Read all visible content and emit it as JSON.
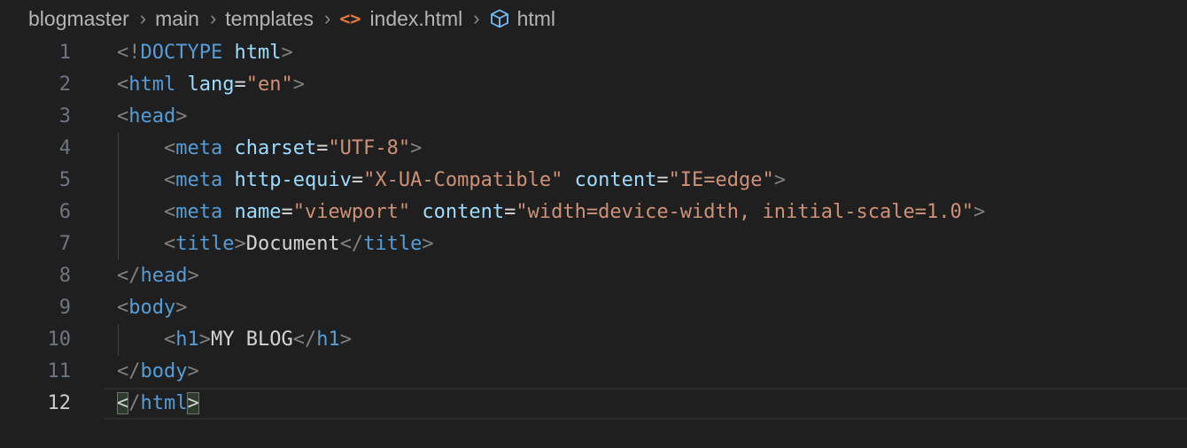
{
  "breadcrumb": {
    "items": [
      "blogmaster",
      "main",
      "templates",
      "index.html",
      "html"
    ],
    "separator": "›"
  },
  "icons": {
    "file": "html-file-icon",
    "symbol": "cube-icon"
  },
  "colors": {
    "background": "#1f1f1f",
    "tag": "#569cd6",
    "attribute": "#9cdcfe",
    "string": "#ce9178",
    "bracket": "#808080",
    "text": "#d4d4d4",
    "file_icon": "#e3793a"
  },
  "editor": {
    "current_line": 12,
    "lines": [
      {
        "n": "1",
        "tokens": [
          [
            "b",
            "<!"
          ],
          [
            "t",
            "DOCTYPE"
          ],
          [
            "x",
            " "
          ],
          [
            "a",
            "html"
          ],
          [
            "b",
            ">"
          ]
        ]
      },
      {
        "n": "2",
        "tokens": [
          [
            "b",
            "<"
          ],
          [
            "t",
            "html"
          ],
          [
            "x",
            " "
          ],
          [
            "a",
            "lang"
          ],
          [
            "x",
            "="
          ],
          [
            "s",
            "\"en\""
          ],
          [
            "b",
            ">"
          ]
        ]
      },
      {
        "n": "3",
        "tokens": [
          [
            "b",
            "<"
          ],
          [
            "t",
            "head"
          ],
          [
            "b",
            ">"
          ]
        ]
      },
      {
        "n": "4",
        "indent": true,
        "tokens": [
          [
            "x",
            "    "
          ],
          [
            "b",
            "<"
          ],
          [
            "t",
            "meta"
          ],
          [
            "x",
            " "
          ],
          [
            "a",
            "charset"
          ],
          [
            "x",
            "="
          ],
          [
            "s",
            "\"UTF-8\""
          ],
          [
            "b",
            ">"
          ]
        ]
      },
      {
        "n": "5",
        "indent": true,
        "tokens": [
          [
            "x",
            "    "
          ],
          [
            "b",
            "<"
          ],
          [
            "t",
            "meta"
          ],
          [
            "x",
            " "
          ],
          [
            "a",
            "http-equiv"
          ],
          [
            "x",
            "="
          ],
          [
            "s",
            "\"X-UA-Compatible\""
          ],
          [
            "x",
            " "
          ],
          [
            "a",
            "content"
          ],
          [
            "x",
            "="
          ],
          [
            "s",
            "\"IE=edge\""
          ],
          [
            "b",
            ">"
          ]
        ]
      },
      {
        "n": "6",
        "indent": true,
        "tokens": [
          [
            "x",
            "    "
          ],
          [
            "b",
            "<"
          ],
          [
            "t",
            "meta"
          ],
          [
            "x",
            " "
          ],
          [
            "a",
            "name"
          ],
          [
            "x",
            "="
          ],
          [
            "s",
            "\"viewport\""
          ],
          [
            "x",
            " "
          ],
          [
            "a",
            "content"
          ],
          [
            "x",
            "="
          ],
          [
            "s",
            "\"width=device-width, initial-scale=1.0\""
          ],
          [
            "b",
            ">"
          ]
        ]
      },
      {
        "n": "7",
        "indent": true,
        "tokens": [
          [
            "x",
            "    "
          ],
          [
            "b",
            "<"
          ],
          [
            "t",
            "title"
          ],
          [
            "b",
            ">"
          ],
          [
            "x",
            "Document"
          ],
          [
            "b",
            "</"
          ],
          [
            "t",
            "title"
          ],
          [
            "b",
            ">"
          ]
        ]
      },
      {
        "n": "8",
        "tokens": [
          [
            "b",
            "</"
          ],
          [
            "t",
            "head"
          ],
          [
            "b",
            ">"
          ]
        ]
      },
      {
        "n": "9",
        "tokens": [
          [
            "b",
            "<"
          ],
          [
            "t",
            "body"
          ],
          [
            "b",
            ">"
          ]
        ]
      },
      {
        "n": "10",
        "indent": true,
        "tokens": [
          [
            "x",
            "    "
          ],
          [
            "b",
            "<"
          ],
          [
            "t",
            "h1"
          ],
          [
            "b",
            ">"
          ],
          [
            "x",
            "MY BLOG"
          ],
          [
            "b",
            "</"
          ],
          [
            "t",
            "h1"
          ],
          [
            "b",
            ">"
          ]
        ]
      },
      {
        "n": "11",
        "tokens": [
          [
            "b",
            "</"
          ],
          [
            "t",
            "body"
          ],
          [
            "b",
            ">"
          ]
        ]
      },
      {
        "n": "12",
        "tokens": [
          [
            "bm",
            "<"
          ],
          [
            "b",
            "/"
          ],
          [
            "t",
            "html"
          ],
          [
            "bm",
            ">"
          ]
        ]
      }
    ]
  }
}
